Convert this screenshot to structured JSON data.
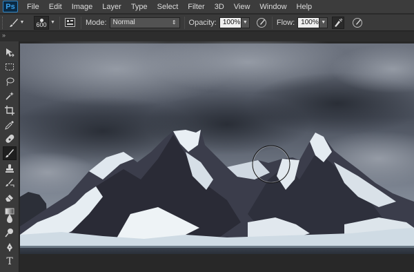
{
  "app": {
    "logo_text": "Ps"
  },
  "menu": [
    "File",
    "Edit",
    "Image",
    "Layer",
    "Type",
    "Select",
    "Filter",
    "3D",
    "View",
    "Window",
    "Help"
  ],
  "options": {
    "brush_size": "600",
    "mode_label": "Mode:",
    "mode_value": "Normal",
    "opacity_label": "Opacity:",
    "opacity_value": "100%",
    "flow_label": "Flow:",
    "flow_value": "100%"
  },
  "tabstrip": {
    "collapse_glyph": "»"
  },
  "tools": [
    "move-tool-icon",
    "marquee-tool-icon",
    "lasso-tool-icon",
    "quick-selection-tool-icon",
    "crop-tool-icon",
    "eyedropper-tool-icon",
    "healing-brush-tool-icon",
    "brush-tool-icon",
    "clone-stamp-tool-icon",
    "history-brush-tool-icon",
    "eraser-tool-icon",
    "gradient-tool-icon",
    "blur-tool-icon",
    "dodge-tool-icon",
    "pen-tool-icon",
    "type-tool-icon"
  ],
  "type_tool_glyph": "T",
  "colors": {
    "menubar": "#3c3c3c",
    "panel": "#3a3a3a",
    "accent_ps": "#39a0ea",
    "sky_dark": "#2f3440",
    "snow": "#e8eef3",
    "rock": "#3a3c4a"
  }
}
